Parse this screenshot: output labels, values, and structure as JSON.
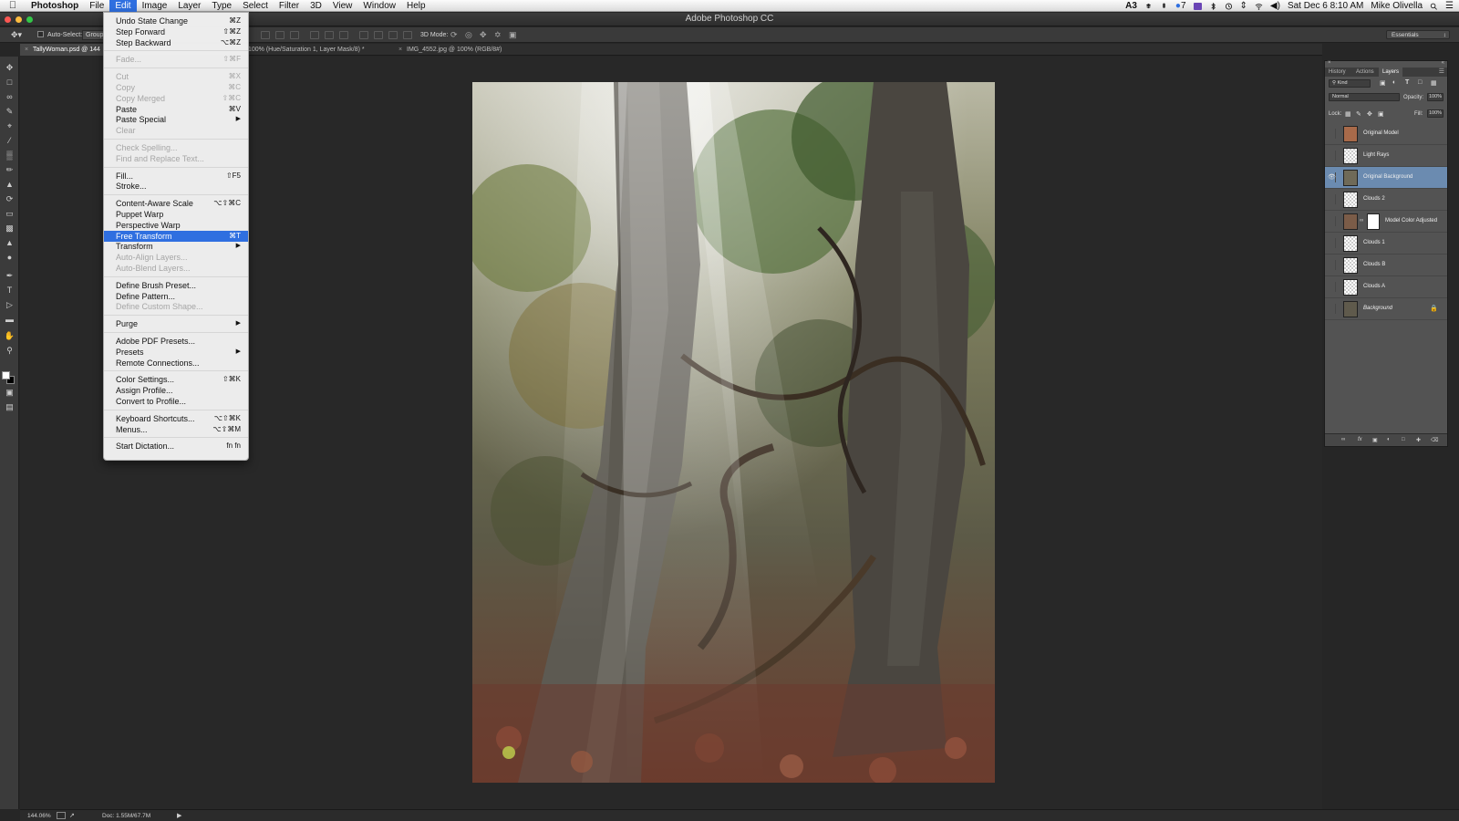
{
  "menubar": {
    "app": "Photoshop",
    "items": [
      "File",
      "Edit",
      "Image",
      "Layer",
      "Type",
      "Select",
      "Filter",
      "3D",
      "View",
      "Window",
      "Help"
    ],
    "active_item": "Edit",
    "status": {
      "adobe_badge": "3",
      "badge_count": "7",
      "datetime": "Sat Dec 6  8:10 AM",
      "user": "Mike Olivella"
    }
  },
  "window": {
    "title": "Adobe Photoshop CC"
  },
  "options_bar": {
    "auto_select_label": "Auto-Select:",
    "auto_select_value": "Group",
    "three_d_mode_label": "3D Mode:",
    "workspace": "Essentials"
  },
  "tabs": [
    {
      "label": "TallyWoman.psd @ 144",
      "active": true
    },
    {
      "label": "100% (Hue/Saturation 1, Layer Mask/8) *",
      "active": false
    },
    {
      "label": "IMG_4552.jpg @ 100% (RGB/8#)",
      "active": false
    }
  ],
  "tools": [
    "move-icon",
    "marquee-icon",
    "lasso-icon",
    "quick-select-icon",
    "crop-icon",
    "eyedropper-icon",
    "healing-icon",
    "brush-icon",
    "stamp-icon",
    "history-brush-icon",
    "eraser-icon",
    "gradient-icon",
    "blur-icon",
    "dodge-icon",
    "pen-icon",
    "type-icon",
    "path-select-icon",
    "shape-icon",
    "hand-icon",
    "zoom-icon"
  ],
  "edit_menu": {
    "items": [
      {
        "label": "Undo State Change",
        "shortcut": "⌘Z",
        "state": "enabled"
      },
      {
        "label": "Step Forward",
        "shortcut": "⇧⌘Z",
        "state": "enabled"
      },
      {
        "label": "Step Backward",
        "shortcut": "⌥⌘Z",
        "state": "enabled"
      },
      {
        "separator": true
      },
      {
        "label": "Fade...",
        "shortcut": "⇧⌘F",
        "state": "disabled"
      },
      {
        "separator": true
      },
      {
        "label": "Cut",
        "shortcut": "⌘X",
        "state": "disabled"
      },
      {
        "label": "Copy",
        "shortcut": "⌘C",
        "state": "disabled"
      },
      {
        "label": "Copy Merged",
        "shortcut": "⇧⌘C",
        "state": "disabled"
      },
      {
        "label": "Paste",
        "shortcut": "⌘V",
        "state": "enabled"
      },
      {
        "label": "Paste Special",
        "submenu": true,
        "state": "enabled"
      },
      {
        "label": "Clear",
        "state": "disabled"
      },
      {
        "separator": true
      },
      {
        "label": "Check Spelling...",
        "state": "disabled"
      },
      {
        "label": "Find and Replace Text...",
        "state": "disabled"
      },
      {
        "separator": true
      },
      {
        "label": "Fill...",
        "shortcut": "⇧F5",
        "state": "enabled"
      },
      {
        "label": "Stroke...",
        "state": "enabled"
      },
      {
        "separator": true
      },
      {
        "label": "Content-Aware Scale",
        "shortcut": "⌥⇧⌘C",
        "state": "enabled"
      },
      {
        "label": "Puppet Warp",
        "state": "enabled"
      },
      {
        "label": "Perspective Warp",
        "state": "enabled"
      },
      {
        "label": "Free Transform",
        "shortcut": "⌘T",
        "state": "highlighted"
      },
      {
        "label": "Transform",
        "submenu": true,
        "state": "enabled"
      },
      {
        "label": "Auto-Align Layers...",
        "state": "disabled"
      },
      {
        "label": "Auto-Blend Layers...",
        "state": "disabled"
      },
      {
        "separator": true
      },
      {
        "label": "Define Brush Preset...",
        "state": "enabled"
      },
      {
        "label": "Define Pattern...",
        "state": "enabled"
      },
      {
        "label": "Define Custom Shape...",
        "state": "disabled"
      },
      {
        "separator": true
      },
      {
        "label": "Purge",
        "submenu": true,
        "state": "enabled"
      },
      {
        "separator": true
      },
      {
        "label": "Adobe PDF Presets...",
        "state": "enabled"
      },
      {
        "label": "Presets",
        "submenu": true,
        "state": "enabled"
      },
      {
        "label": "Remote Connections...",
        "state": "enabled"
      },
      {
        "separator": true
      },
      {
        "label": "Color Settings...",
        "shortcut": "⇧⌘K",
        "state": "enabled"
      },
      {
        "label": "Assign Profile...",
        "state": "enabled"
      },
      {
        "label": "Convert to Profile...",
        "state": "enabled"
      },
      {
        "separator": true
      },
      {
        "label": "Keyboard Shortcuts...",
        "shortcut": "⌥⇧⌘K",
        "state": "enabled"
      },
      {
        "label": "Menus...",
        "shortcut": "⌥⇧⌘M",
        "state": "enabled"
      },
      {
        "separator": true
      },
      {
        "label": "Start Dictation...",
        "shortcut": "fn fn",
        "state": "enabled"
      }
    ]
  },
  "layers_panel": {
    "tabs": [
      "History",
      "Actions",
      "Layers"
    ],
    "active_tab": "Layers",
    "filter_kind": "Kind",
    "blend_mode": "Normal",
    "opacity_label": "Opacity:",
    "opacity": "100%",
    "lock_label": "Lock:",
    "fill_label": "Fill:",
    "fill": "100%",
    "layers": [
      {
        "name": "Original Model",
        "visible": false,
        "selected": false,
        "has_mask": false,
        "locked": false
      },
      {
        "name": "Light Rays",
        "visible": false,
        "selected": false,
        "has_mask": false,
        "locked": false
      },
      {
        "name": "Original Background",
        "visible": true,
        "selected": true,
        "has_mask": false,
        "locked": false
      },
      {
        "name": "Clouds 2",
        "visible": false,
        "selected": false,
        "has_mask": false,
        "locked": false
      },
      {
        "name": "Model Color Adjusted",
        "visible": false,
        "selected": false,
        "has_mask": true,
        "locked": false
      },
      {
        "name": "Clouds 1",
        "visible": false,
        "selected": false,
        "has_mask": false,
        "locked": false
      },
      {
        "name": "Clouds B",
        "visible": false,
        "selected": false,
        "has_mask": false,
        "locked": false
      },
      {
        "name": "Clouds A",
        "visible": false,
        "selected": false,
        "has_mask": false,
        "locked": false
      },
      {
        "name": "Background",
        "visible": false,
        "selected": false,
        "has_mask": false,
        "locked": true
      }
    ]
  },
  "status_bar": {
    "zoom": "144.06%",
    "doc_size": "Doc: 1.55M/67.7M"
  },
  "colors": {
    "menu_highlight": "#2f6fe0",
    "layer_selected": "#6b8bb0",
    "workspace_bg": "#262626"
  }
}
